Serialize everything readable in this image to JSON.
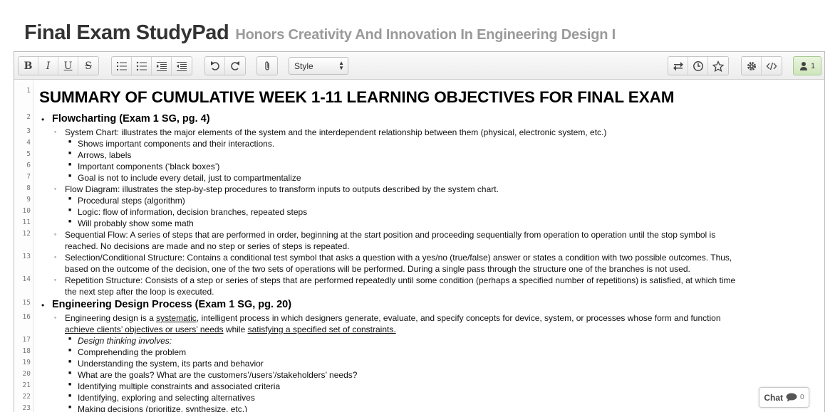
{
  "pad": {
    "title": "Final Exam StudyPad",
    "subtitle": "Honors Creativity And Innovation In Engineering Design I"
  },
  "toolbar": {
    "style_label": "Style",
    "user_count": "1",
    "icons": [
      "bold-icon",
      "italic-icon",
      "underline-icon",
      "strikethrough-icon",
      "ordered-list-icon",
      "unordered-list-icon",
      "indent-icon",
      "outdent-icon",
      "undo-icon",
      "redo-icon",
      "attach-icon",
      "import-export-icon",
      "timeslider-icon",
      "star-icon",
      "settings-icon",
      "embed-icon",
      "users-icon"
    ]
  },
  "document": {
    "lines": [
      {
        "n": "1",
        "text": "SUMMARY OF CUMULATIVE WEEK 1-11 LEARNING OBJECTIVES FOR FINAL EXAM"
      },
      {
        "n": "2",
        "text": "Flowcharting (Exam 1 SG, pg. 4)"
      },
      {
        "n": "3",
        "text": "System Chart: illustrates the major elements of the system and the interdependent relationship between them (physical, electronic system, etc.)"
      },
      {
        "n": "4",
        "text": "Shows important components and their interactions."
      },
      {
        "n": "5",
        "text": "Arrows, labels"
      },
      {
        "n": "6",
        "text": "Important components (‘black boxes’)"
      },
      {
        "n": "7",
        "text": "Goal is not to include every detail, just to compartmentalize"
      },
      {
        "n": "8",
        "text": "Flow Diagram: illustrates the step-by-step procedures to transform inputs to outputs described by the system chart."
      },
      {
        "n": "9",
        "text": "Procedural steps (algorithm)"
      },
      {
        "n": "10",
        "text": "Logic: flow of information, decision branches, repeated steps"
      },
      {
        "n": "11",
        "text": "Will probably show some math"
      },
      {
        "n": "12",
        "text": "Sequential Flow: A series of steps that are performed in order, beginning at the start position and proceeding sequentially from operation to operation until the stop symbol is",
        "text2": "reached.  No decisions are made and no step or series of steps is repeated."
      },
      {
        "n": "13",
        "text": "Selection/Conditional Structure: Contains a conditional test symbol that asks a question with a yes/no (true/false) answer or states a condition with two possible outcomes.  Thus,",
        "text2": "based on the outcome of the decision, one of the two sets of operations will be performed.  During a single pass through the structure one of the branches is not used."
      },
      {
        "n": "14",
        "text": "Repetition Structure: Consists of a step or  series of steps that are performed repeatedly until some condition (perhaps a specified number of repetitions) is satisfied, at which time",
        "text2": "the next step after the loop is executed."
      },
      {
        "n": "15",
        "text": "Engineering Design Process (Exam 1 SG, pg. 20)"
      },
      {
        "n": "16",
        "parts": [
          "Engineering design is a ",
          "systematic",
          ", intelligent process in which designers generate, evaluate, and specify concepts for device, system, or processes whose form and function"
        ],
        "parts2": [
          "achieve clients’ objectives or users’ needs",
          " while ",
          "satisfying a specified set of constraints."
        ]
      },
      {
        "n": "17",
        "text": "Design thinking involves:"
      },
      {
        "n": "18",
        "text": "Comprehending the problem"
      },
      {
        "n": "19",
        "text": "Understanding the system, its parts and behavior"
      },
      {
        "n": "20",
        "text": "What are the goals?  What are the customers’/users’/stakeholders’ needs?"
      },
      {
        "n": "21",
        "text": "Identifying multiple constraints and associated criteria"
      },
      {
        "n": "22",
        "text": "Identifying, exploring and selecting alternatives"
      },
      {
        "n": "23",
        "text": "Making decisions (prioritize, synthesize, etc.)"
      }
    ]
  },
  "chat": {
    "label": "Chat",
    "count": "0"
  }
}
